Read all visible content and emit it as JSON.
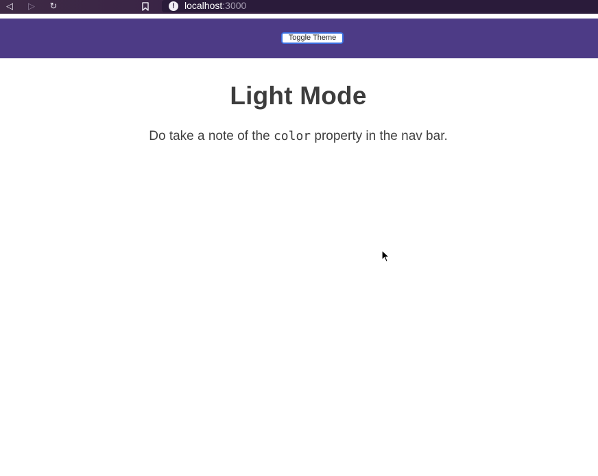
{
  "browser": {
    "back_icon": "◁",
    "forward_icon": "▷",
    "reload_icon": "↻",
    "bookmark_icon": "bookmark-icon",
    "info_icon": "!",
    "url_host": "localhost",
    "url_port": ":3000"
  },
  "navbar": {
    "toggle_label": "Toggle Theme",
    "background_color": "#4d3b86"
  },
  "main": {
    "title": "Light Mode",
    "subtitle_before": "Do take a note of the ",
    "subtitle_code": "color",
    "subtitle_after": " property in the nav bar."
  }
}
